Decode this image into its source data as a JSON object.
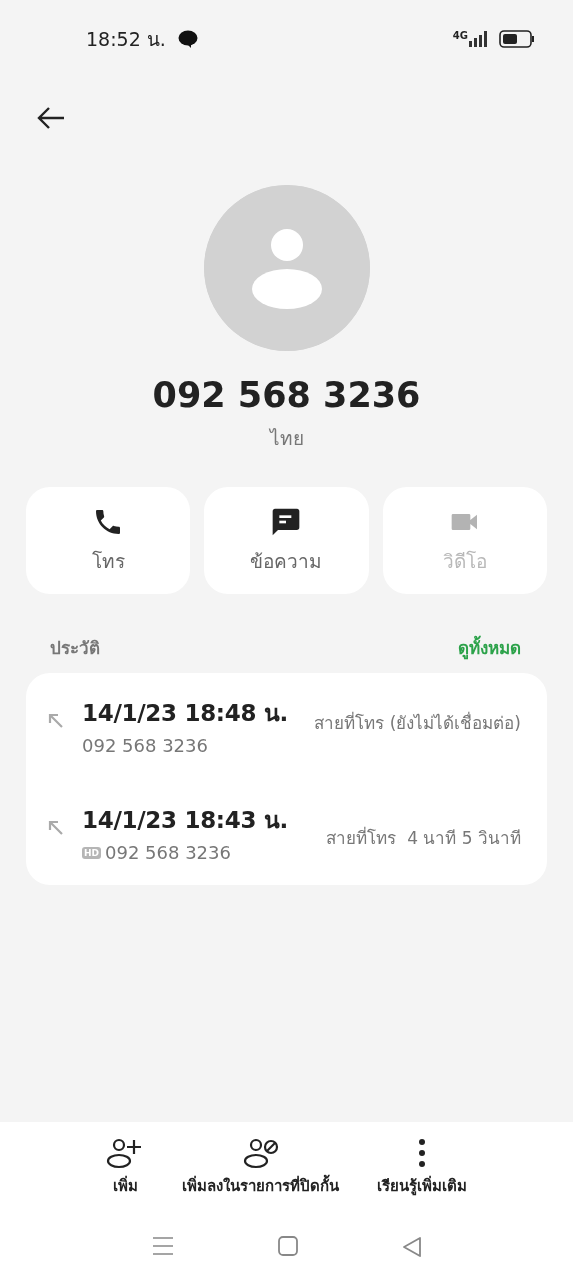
{
  "status_bar": {
    "time": "18:52 น.",
    "network": "4G"
  },
  "contact": {
    "number": "092 568 3236",
    "location": "ไทย"
  },
  "actions": [
    {
      "kind": "call",
      "label": "โทร",
      "disabled": false
    },
    {
      "kind": "message",
      "label": "ข้อความ",
      "disabled": false
    },
    {
      "kind": "video",
      "label": "วิดีโอ",
      "disabled": true
    }
  ],
  "history": {
    "title": "ประวัติ",
    "link": "ดูทั้งหมด",
    "entries": [
      {
        "datetime": "14/1/23 18:48 น.",
        "number": "092 568 3236",
        "status": "สายที่โทร (ยังไม่ได้เชื่อมต่อ)"
      },
      {
        "datetime": "14/1/23 18:43 น.",
        "badge": "HD",
        "number": "092 568 3236",
        "status": "สายที่โทร  4 นาที 5 วินาที"
      }
    ]
  },
  "bottom_actions": [
    {
      "kind": "add",
      "label": "เพิ่ม"
    },
    {
      "kind": "block",
      "label": "เพิ่มลงในรายการที่ปิดกั้น"
    },
    {
      "kind": "more",
      "label": "เรียนรู้เพิ่มเติม"
    }
  ]
}
